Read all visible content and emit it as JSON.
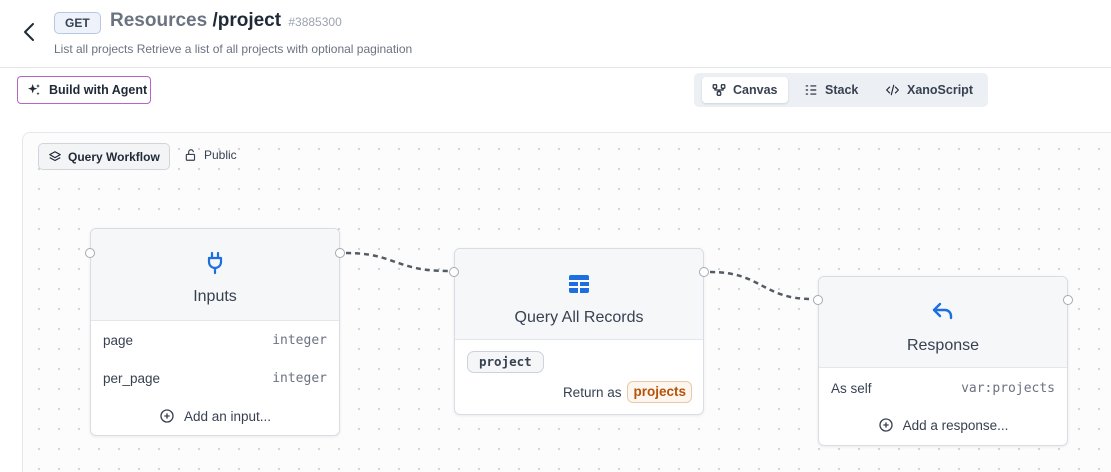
{
  "header": {
    "method": "GET",
    "title_prefix": "Resources ",
    "title_path": "/project",
    "record_id": "#3885300",
    "description": "List all projects Retrieve a list of all projects with optional pagination"
  },
  "toolbar": {
    "agent_label": "Build with Agent",
    "views": [
      {
        "label": "Canvas",
        "icon": "canvas-icon",
        "active": true
      },
      {
        "label": "Stack",
        "icon": "stack-icon",
        "active": false
      },
      {
        "label": "XanoScript",
        "icon": "code-icon",
        "active": false
      }
    ]
  },
  "canvas": {
    "workflow_label": "Query Workflow",
    "visibility_label": "Public",
    "nodes": {
      "inputs": {
        "title": "Inputs",
        "icon": "plug-icon",
        "rows": [
          {
            "name": "page",
            "type": "integer"
          },
          {
            "name": "per_page",
            "type": "integer"
          }
        ],
        "add_label": "Add an input..."
      },
      "query": {
        "title": "Query All Records",
        "icon": "table-icon",
        "table": "project",
        "return_label": "Return as",
        "return_var": "projects"
      },
      "response": {
        "title": "Response",
        "icon": "reply-icon",
        "row_label": "As self",
        "row_value": "var:projects",
        "add_label": "Add a response..."
      }
    }
  },
  "colors": {
    "accent_blue": "#1d6fe0",
    "agent_border": "#b565c5",
    "return_chip": "#b45309"
  }
}
